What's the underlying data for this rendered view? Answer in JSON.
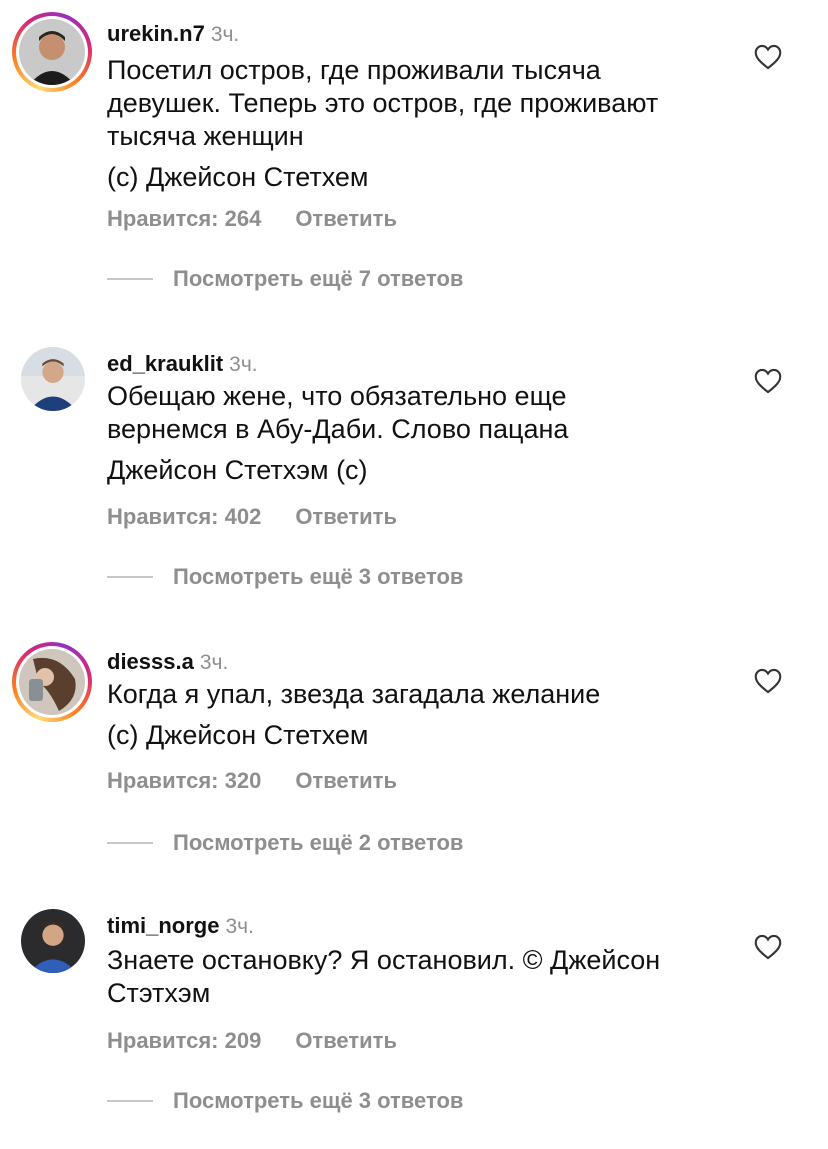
{
  "comments": [
    {
      "username": "urekin.n7",
      "time": "3ч.",
      "lines": [
        "Посетил остров, где проживали тысяча",
        "девушек. Теперь это остров, где проживают",
        "тысяча женщин",
        "(с) Джейсон Стетхем"
      ],
      "likes": "Нравится: 264",
      "reply": "Ответить",
      "more_replies": "Посмотреть ещё 7 ответов",
      "story_ring": true
    },
    {
      "username": "ed_krauklit",
      "time": "3ч.",
      "lines": [
        "Обещаю жене, что обязательно еще",
        "вернемся в Абу-Даби. Слово пацана",
        "Джейсон Стетхэм (с)"
      ],
      "likes": "Нравится: 402",
      "reply": "Ответить",
      "more_replies": "Посмотреть ещё 3 ответов",
      "story_ring": false
    },
    {
      "username": "diesss.a",
      "time": "3ч.",
      "lines": [
        "Когда я упал, звезда загадала желание",
        "(с) Джейсон Стетхем"
      ],
      "likes": "Нравится: 320",
      "reply": "Ответить",
      "more_replies": "Посмотреть ещё 2 ответов",
      "story_ring": true
    },
    {
      "username": "timi_norge",
      "time": "3ч.",
      "lines": [
        "Знаете остановку? Я остановил. © Джейсон",
        "Стэтхэм"
      ],
      "likes": "Нравится: 209",
      "reply": "Ответить",
      "more_replies": "Посмотреть ещё 3 ответов",
      "story_ring": false
    }
  ],
  "icons": {
    "like": "heart-outline-icon",
    "avatar": "user-avatar"
  },
  "colors": {
    "text": "#111111",
    "muted": "#8e8e8e",
    "divider": "#c7c7c7"
  }
}
